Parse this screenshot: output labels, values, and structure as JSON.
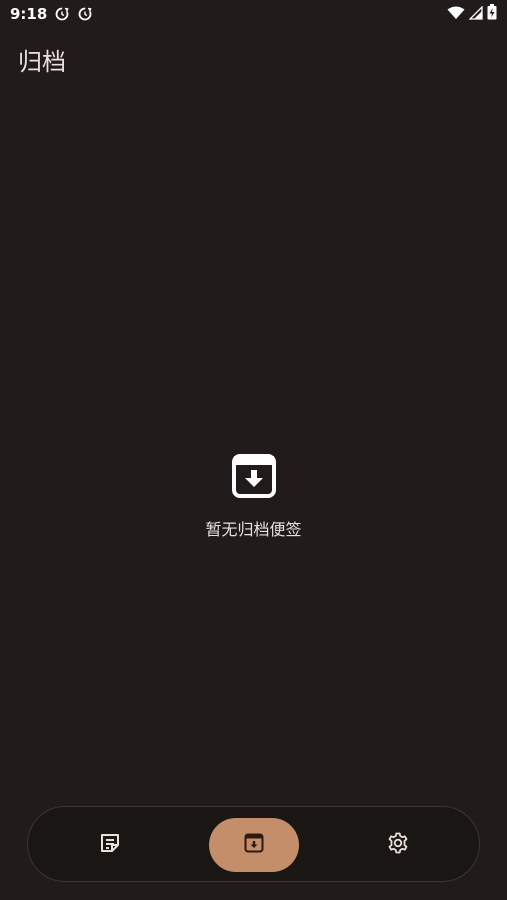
{
  "status_bar": {
    "time": "9:18",
    "icons_left": [
      "sync-icon",
      "sync-icon"
    ],
    "icons_right": [
      "wifi-icon",
      "cellular-icon",
      "battery-charging-icon"
    ]
  },
  "page": {
    "title": "归档"
  },
  "empty_state": {
    "icon": "archive-box-icon",
    "message": "暂无归档便签"
  },
  "bottom_nav": {
    "items": [
      {
        "id": "notes",
        "icon": "note-icon",
        "active": false
      },
      {
        "id": "archive",
        "icon": "archive-icon",
        "active": true
      },
      {
        "id": "settings",
        "icon": "gear-icon",
        "active": false
      }
    ]
  },
  "colors": {
    "background": "#211c1b",
    "nav_background": "#1a1614",
    "active_pill": "#c58e6b",
    "text": "#ece0dc"
  }
}
